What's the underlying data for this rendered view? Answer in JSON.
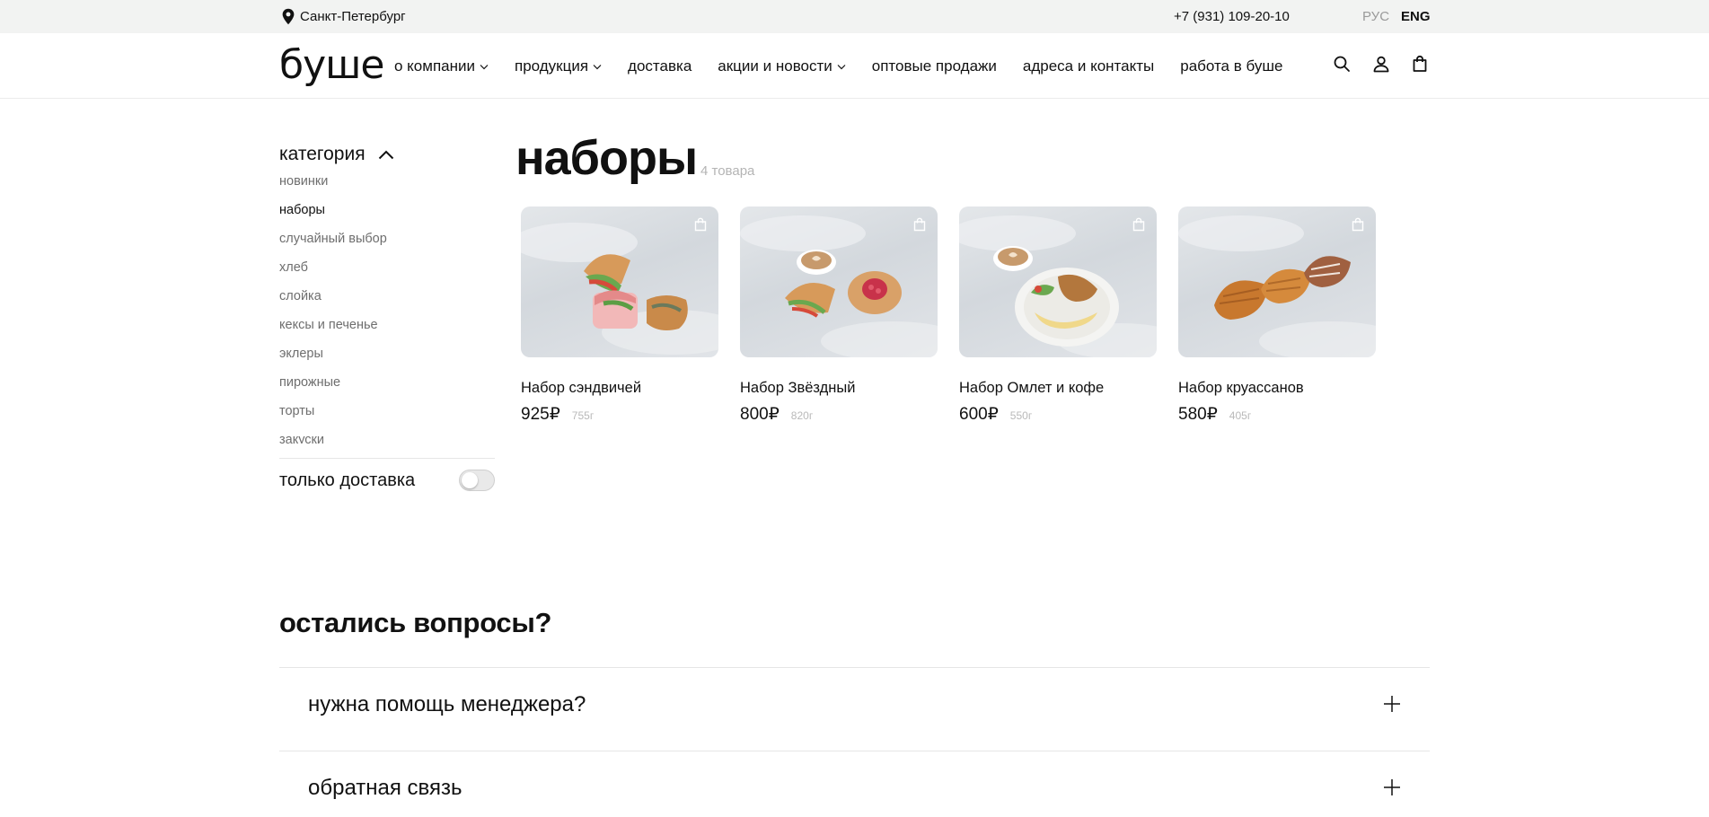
{
  "topbar": {
    "city": "Санкт-Петербург",
    "phone": "+7 (931) 109-20-10",
    "lang_ru": "РУС",
    "lang_en": "ENG"
  },
  "header": {
    "logo": "буше",
    "nav": [
      {
        "label": "о компании",
        "has_dropdown": true
      },
      {
        "label": "продукция",
        "has_dropdown": true
      },
      {
        "label": "доставка",
        "has_dropdown": false
      },
      {
        "label": "акции и новости",
        "has_dropdown": true
      },
      {
        "label": "оптовые продажи",
        "has_dropdown": false
      },
      {
        "label": "адреса и контакты",
        "has_dropdown": false
      },
      {
        "label": "работа в буше",
        "has_dropdown": false
      }
    ],
    "icons": [
      "search-icon",
      "user-icon",
      "cart-icon"
    ]
  },
  "sidebar": {
    "category_title": "категория",
    "categories": [
      {
        "label": "новинки",
        "active": false
      },
      {
        "label": "наборы",
        "active": true
      },
      {
        "label": "случайный выбор",
        "active": false
      },
      {
        "label": "хлеб",
        "active": false
      },
      {
        "label": "слойка",
        "active": false
      },
      {
        "label": "кексы и печенье",
        "active": false
      },
      {
        "label": "эклеры",
        "active": false
      },
      {
        "label": "пирожные",
        "active": false
      },
      {
        "label": "торты",
        "active": false
      },
      {
        "label": "закуски",
        "active": false
      }
    ],
    "delivery_only_label": "только доставка",
    "delivery_only_enabled": false
  },
  "main": {
    "title": "наборы",
    "count": "4 товара",
    "products": [
      {
        "name": "Набор сэндвичей",
        "price": "925₽",
        "weight": "755г"
      },
      {
        "name": "Набор Звёздный",
        "price": "800₽",
        "weight": "820г"
      },
      {
        "name": "Набор Омлет и кофе",
        "price": "600₽",
        "weight": "550г"
      },
      {
        "name": "Набор круассанов",
        "price": "580₽",
        "weight": "405г"
      }
    ]
  },
  "questions": {
    "title": "остались вопросы?",
    "items": [
      {
        "label": "нужна помощь менеджера?"
      },
      {
        "label": "обратная связь"
      }
    ]
  },
  "colors": {
    "topbar_bg": "#f2f3f2",
    "text": "#111111",
    "muted": "#6e6e6e",
    "price_weight": "#b9b9b9",
    "lang_inactive": "#9a9a9a"
  }
}
